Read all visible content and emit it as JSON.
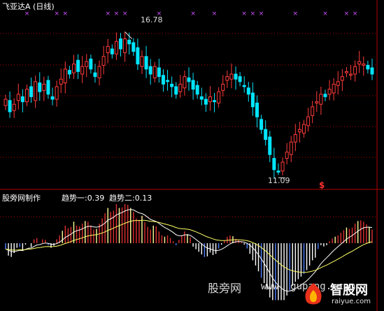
{
  "main_panel": {
    "title": "飞亚达A (日线)"
  },
  "sub_panel": {
    "title": "股旁网制作",
    "trend1": "趋势一:0.39",
    "trend2": "趋势二:0.13"
  },
  "annotations": {
    "high_label": "16.78",
    "low_label": "11.09",
    "signal_mark": "$"
  },
  "watermark": {
    "text1": "股旁网",
    "text2": "www. gupang. com",
    "brand": "智股网",
    "brand_url": "raiyue.com"
  },
  "colors": {
    "up": "#ff3b3b",
    "down": "#00e5ff",
    "marker": "#d050ff",
    "grid": "#b00000",
    "osc_pos": "#e03030",
    "osc_pos_hi": "#ffff99",
    "osc_neg": "#ffffff",
    "osc_neg_hi": "#5080ff",
    "line1": "#ffffff",
    "line2": "#ffff66"
  },
  "chart_data": [
    {
      "type": "candlestick",
      "title": "飞亚达A (日线)",
      "ylim": [
        10.6,
        17.6
      ],
      "high": 16.78,
      "low": 11.09,
      "close": [
        14.1,
        13.6,
        13.9,
        14.3,
        14.0,
        14.5,
        14.2,
        14.8,
        14.4,
        14.7,
        14.3,
        14.1,
        14.6,
        14.9,
        15.3,
        15.1,
        15.5,
        15.2,
        15.4,
        15.6,
        15.3,
        15.0,
        15.4,
        15.8,
        16.2,
        15.9,
        16.4,
        16.1,
        16.5,
        16.3,
        16.0,
        15.5,
        15.8,
        15.3,
        15.1,
        15.4,
        15.0,
        14.7,
        14.8,
        14.6,
        14.3,
        14.7,
        15.0,
        14.8,
        14.5,
        14.3,
        14.1,
        13.9,
        14.2,
        14.0,
        14.4,
        14.7,
        15.0,
        15.1,
        14.9,
        14.8,
        14.6,
        14.3,
        13.8,
        13.4,
        12.9,
        12.5,
        11.9,
        11.3,
        11.2,
        11.6,
        12.0,
        12.4,
        12.7,
        12.9,
        13.1,
        13.4,
        13.8,
        14.0,
        14.3,
        14.2,
        14.5,
        14.7,
        14.8,
        15.0,
        15.2,
        15.1,
        15.4,
        15.6,
        15.5,
        15.3,
        15.1
      ],
      "marker_text": "×"
    },
    {
      "type": "bar",
      "title": "股旁网制作",
      "series": [
        {
          "name": "趋势一",
          "value": 0.39
        },
        {
          "name": "趋势二",
          "value": 0.13
        }
      ],
      "ylim": [
        -1.6,
        1.1
      ]
    }
  ]
}
